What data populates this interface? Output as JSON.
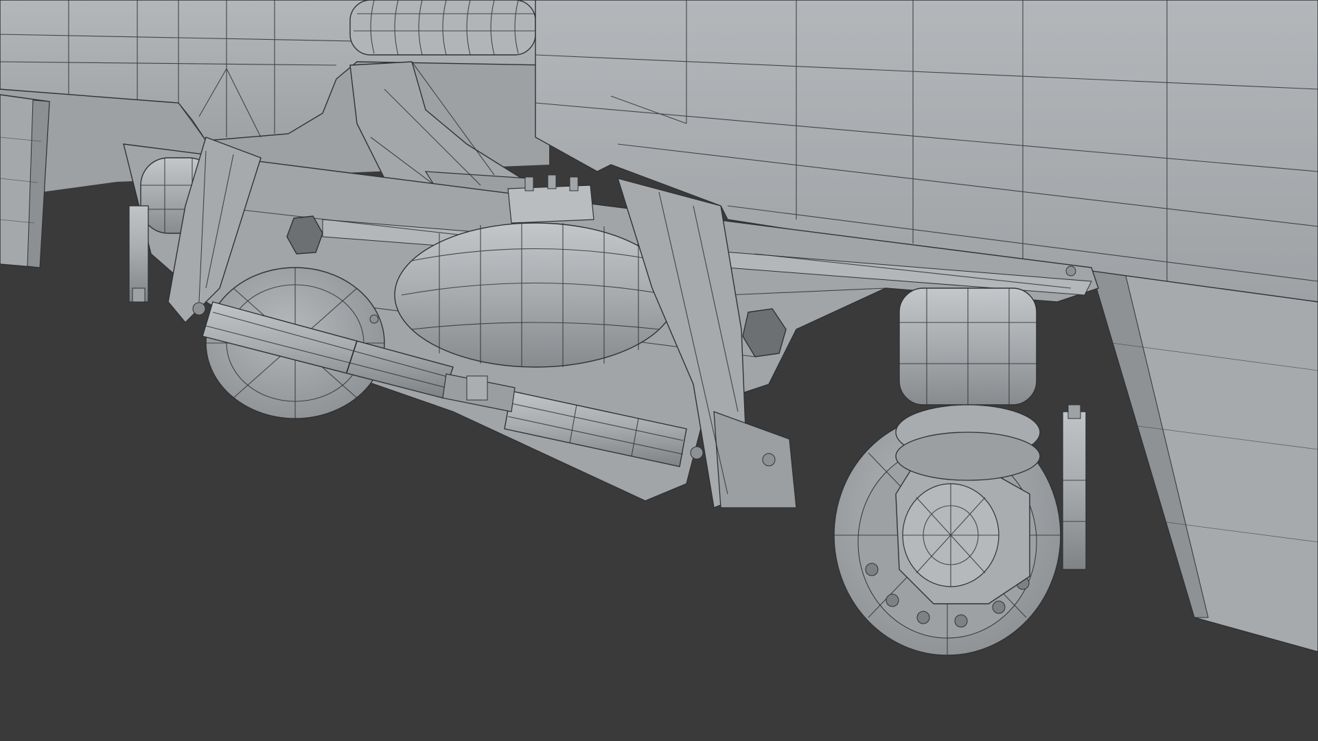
{
  "viewport": {
    "background_color": "#3a3a3a",
    "mesh_fill_color": "#a9adb0",
    "mesh_shadow_color": "#8e9296",
    "mesh_highlight_color": "#c1c5c8",
    "wire_color": "#2e3134",
    "display_mode": "solid-wireframe"
  },
  "scene": {
    "objects": [
      "railcar-body-left",
      "railcar-body-right",
      "bellows-connector",
      "bogie-frame",
      "air-spring-center",
      "air-spring-rear",
      "air-spring-front",
      "wheel-front",
      "wheel-rear",
      "axle-box",
      "damper-cylinder-left",
      "damper-cylinder-center",
      "vertical-damper-left",
      "vertical-damper-right",
      "traction-link",
      "skirt-panel-left",
      "skirt-panel-right"
    ]
  }
}
